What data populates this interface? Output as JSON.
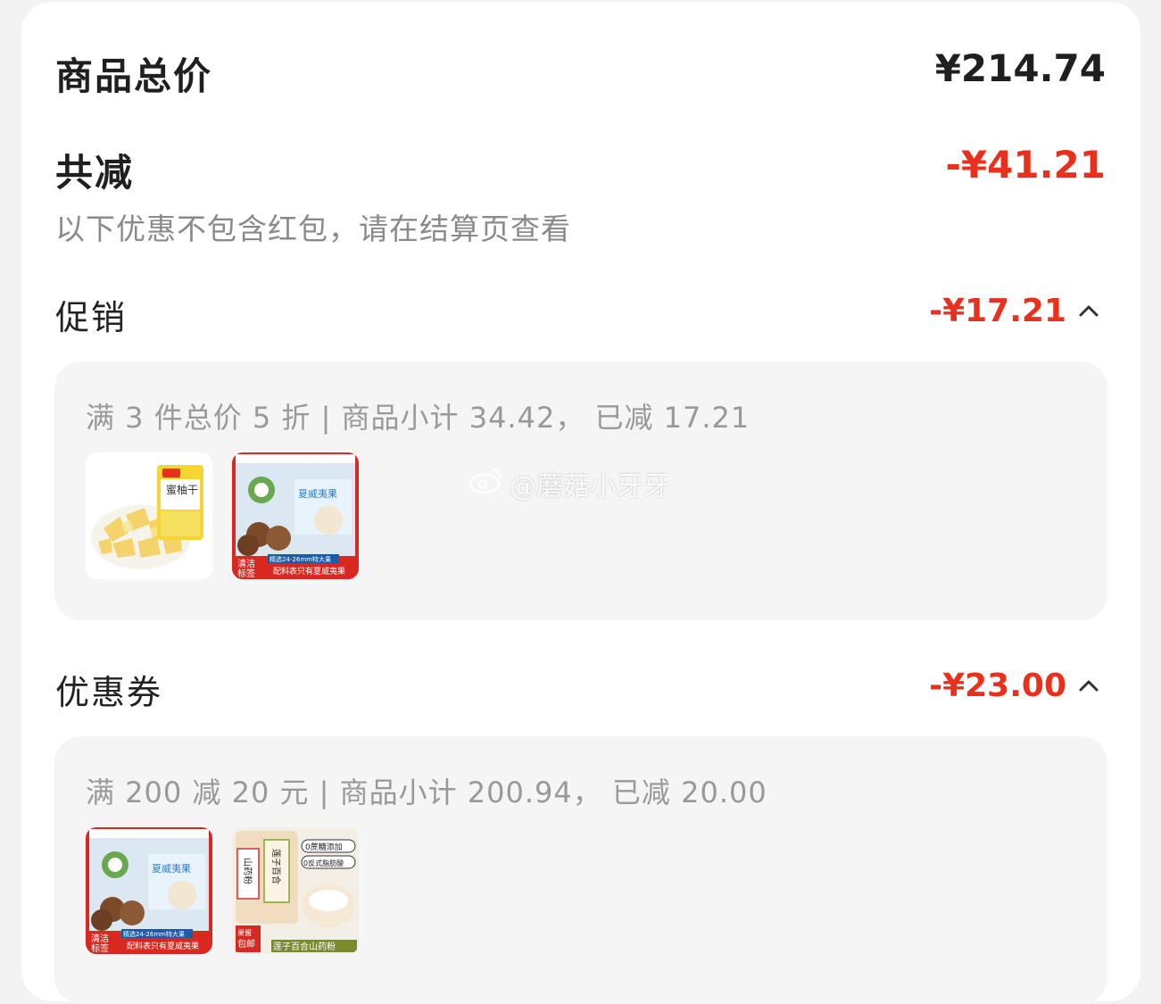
{
  "summary": {
    "total_label": "商品总价",
    "total_value": "¥214.74",
    "reduce_label": "共减",
    "reduce_value": "-¥41.21",
    "note": "以下优惠不包含红包，请在结算页查看"
  },
  "promotion": {
    "label": "促销",
    "value": "-¥17.21",
    "detail": "满 3 件总价 5 折 | 商品小计 34.42， 已减 17.21",
    "products": [
      {
        "name": "蜜柚干",
        "badge": ""
      },
      {
        "name": "夏威夷果",
        "badge_line1": "清洁",
        "badge_line2": "标签",
        "tag": "精选24-26mm特大果",
        "caption": "配料表只有夏威夷果",
        "center": "夏威夷果"
      }
    ]
  },
  "coupon": {
    "label": "优惠券",
    "value": "-¥23.00",
    "detail": "满 200 减 20 元 | 商品小计 200.94， 已减 20.00",
    "products": [
      {
        "name": "夏威夷果",
        "badge_line1": "清洁",
        "badge_line2": "标签",
        "tag": "精选24-26mm特大果",
        "caption": "配料表只有夏威夷果",
        "center": "夏威夷果"
      },
      {
        "name": "莲子百合山药粉",
        "left": "山药粉",
        "right": "莲子百合",
        "badge_line1": "果酱",
        "badge_line2": "包邮",
        "tag1": "0蔗糖添加",
        "tag2": "0反式脂肪酸",
        "caption": "莲子百合山药粉"
      }
    ]
  },
  "watermark": {
    "text": "@蘑菇小牙牙"
  },
  "colors": {
    "accent": "#e8301d",
    "muted": "#999999",
    "panel": "#f5f5f5"
  }
}
